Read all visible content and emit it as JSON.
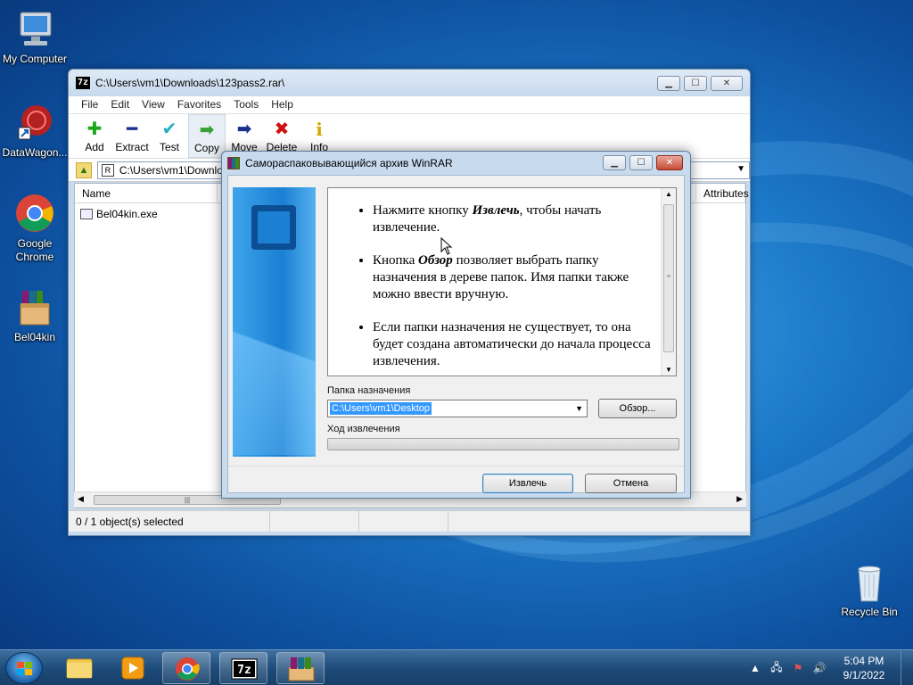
{
  "desktop": {
    "icons": [
      {
        "label": "My Computer"
      },
      {
        "label": "DataWagon..."
      },
      {
        "label": "Google\nChrome"
      },
      {
        "label": "Bel04kin"
      },
      {
        "label": "Recycle Bin"
      }
    ]
  },
  "main_window": {
    "title": "C:\\Users\\vm1\\Downloads\\123pass2.rar\\",
    "app_icon_text": "7z",
    "menu": [
      "File",
      "Edit",
      "View",
      "Favorites",
      "Tools",
      "Help"
    ],
    "toolbar": [
      {
        "label": "Add",
        "glyph": "✚",
        "color": "#1aa81a"
      },
      {
        "label": "Extract",
        "glyph": "━",
        "color": "#1b2f8f"
      },
      {
        "label": "Test",
        "glyph": "✔",
        "color": "#20b0c0"
      },
      {
        "label": "Copy",
        "glyph": "➡",
        "color": "#3aa03a"
      },
      {
        "label": "Move",
        "glyph": "➡",
        "color": "#1b2f8f"
      },
      {
        "label": "Delete",
        "glyph": "✖",
        "color": "#d01010"
      },
      {
        "label": "Info",
        "glyph": "i",
        "color": "#d4a800"
      }
    ],
    "address": "C:\\Users\\vm1\\Downloads\\123pass2.rar\\",
    "columns": [
      "Name",
      "Attributes"
    ],
    "files": [
      "Bel04kin.exe"
    ],
    "status": "0 / 1 object(s) selected"
  },
  "sfx_dialog": {
    "title": "Самораспаковывающийся архив WinRAR",
    "info": [
      {
        "pre": "Нажмите кнопку ",
        "bold": "Извлечь",
        "post": ", чтобы начать извлечение."
      },
      {
        "pre": "Кнопка ",
        "bold": "Обзор",
        "post": " позволяет выбрать папку назначения в дереве папок. Имя папки также можно ввести вручную."
      },
      {
        "pre": "Если папки назначения не существует, то она будет создана автоматически до начала процесса извлечения.",
        "bold": "",
        "post": ""
      }
    ],
    "dest_label": "Папка назначения",
    "dest_value": "C:\\Users\\vm1\\Desktop",
    "browse_label": "Обзор...",
    "progress_label": "Ход извлечения",
    "progress": 0,
    "extract_label": "Извлечь",
    "cancel_label": "Отмена"
  },
  "taskbar": {
    "time": "5:04 PM",
    "date": "9/1/2022"
  }
}
